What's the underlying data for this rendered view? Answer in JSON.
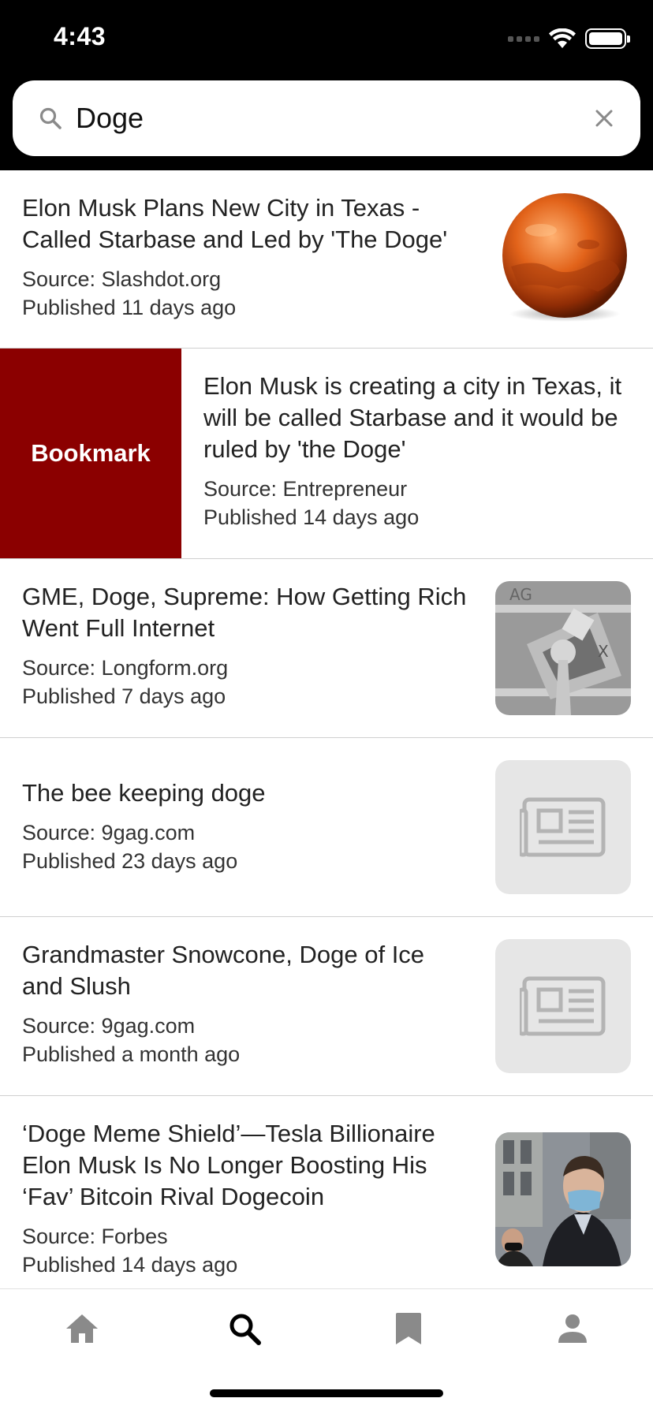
{
  "status_bar": {
    "time": "4:43"
  },
  "search": {
    "value": "Doge",
    "placeholder": ""
  },
  "articles": [
    {
      "title": "Elon Musk Plans New City in Texas - Called Starbase and Led by 'The Doge'",
      "source": "Source: Slashdot.org",
      "published": "Published 11 days ago",
      "thumbnail": "mars-planet-image"
    },
    {
      "title": "Elon Musk is creating a city in Texas, it will be called Starbase and it would be ruled by 'the Doge'",
      "source": "Source: Entrepreneur",
      "published": "Published 14 days ago",
      "thumbnail": "none",
      "swipe_action": "Bookmark"
    },
    {
      "title": "GME, Doge, Supreme: How Getting Rich Went Full Internet",
      "source": "Source: Longform.org",
      "published": "Published 7 days ago",
      "thumbnail": "collage-image"
    },
    {
      "title": "The bee keeping doge",
      "source": "Source: 9gag.com",
      "published": "Published 23 days ago",
      "thumbnail": "newspaper-placeholder-icon"
    },
    {
      "title": "Grandmaster Snowcone, Doge of Ice and Slush",
      "source": "Source: 9gag.com",
      "published": "Published a month ago",
      "thumbnail": "newspaper-placeholder-icon"
    },
    {
      "title": "‘Doge Meme Shield’—Tesla Billionaire Elon Musk Is No Longer Boosting His ‘Fav’ Bitcoin Rival Dogecoin",
      "source": "Source: Forbes",
      "published": "Published 14 days ago",
      "thumbnail": "person-photo"
    }
  ],
  "tab_bar": {
    "tabs": [
      {
        "icon": "home-icon",
        "active": false
      },
      {
        "icon": "search-icon",
        "active": true
      },
      {
        "icon": "bookmark-icon",
        "active": false
      },
      {
        "icon": "profile-icon",
        "active": false
      }
    ]
  },
  "colors": {
    "accent_bookmark": "#8b0000",
    "header_bg": "#000000",
    "tab_inactive": "#8a8a8a",
    "tab_active": "#000000"
  }
}
